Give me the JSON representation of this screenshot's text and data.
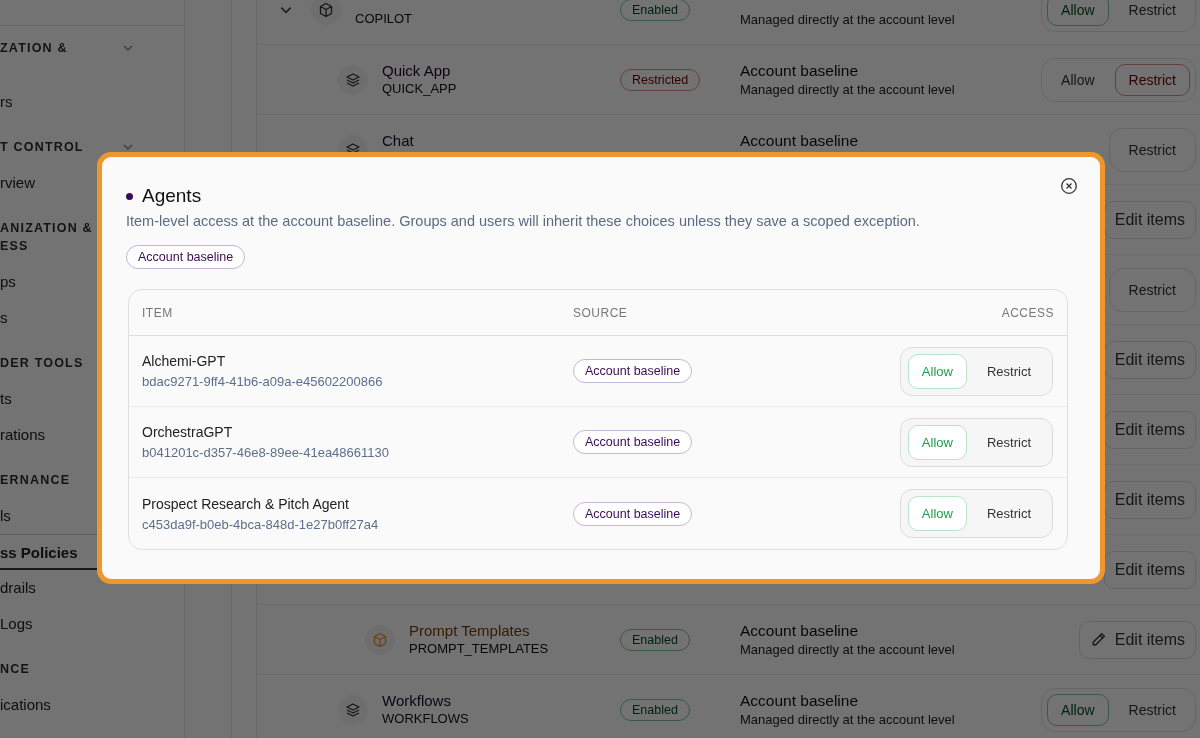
{
  "sidebar": {
    "sections": [
      {
        "heading": [
          "ZATION &"
        ],
        "collapsible": true,
        "items": [
          {
            "label": "rs",
            "selected": false
          }
        ]
      },
      {
        "heading": [
          "T CONTROL"
        ],
        "collapsible": true,
        "items": [
          {
            "label": "rview",
            "selected": false
          }
        ]
      },
      {
        "heading": [
          "ANIZATION &",
          "ESS"
        ],
        "collapsible": false,
        "items": [
          {
            "label": "ps",
            "selected": false
          },
          {
            "label": "s",
            "selected": false
          }
        ]
      },
      {
        "heading": [
          "DER TOOLS"
        ],
        "collapsible": false,
        "items": [
          {
            "label": "ts",
            "selected": false
          },
          {
            "label": "rations",
            "selected": false
          }
        ]
      },
      {
        "heading": [
          "ERNANCE"
        ],
        "collapsible": false,
        "items": [
          {
            "label": "ls",
            "selected": false
          },
          {
            "label": "ss Policies",
            "selected": true
          },
          {
            "label": "drails",
            "selected": false
          },
          {
            "label": "Logs",
            "selected": false
          }
        ]
      },
      {
        "heading": [
          "NCE"
        ],
        "collapsible": false,
        "items": [
          {
            "label": "ications",
            "selected": false
          }
        ]
      }
    ]
  },
  "policies": [
    {
      "kind": "category",
      "expanded": true,
      "code": "COPILOT",
      "status": "Enabled",
      "note": "Managed directly at the account level",
      "access": {
        "kind": "toggle",
        "options": [
          {
            "label": "Allow",
            "selected": true
          },
          {
            "label": "Restrict",
            "selected": false
          }
        ]
      },
      "children": [
        {
          "kind": "tool",
          "name": "Quick App",
          "code": "QUICK_APP",
          "status": "Restricted",
          "source": "Account baseline",
          "note": "Managed directly at the account level",
          "access": {
            "kind": "toggle",
            "options": [
              {
                "label": "Allow",
                "selected": false
              },
              {
                "label": "Restrict",
                "selected": true
              }
            ]
          }
        },
        {
          "kind": "tool",
          "name": "Chat",
          "source": "Account baseline",
          "access": {
            "kind": "toggle",
            "options": [
              {
                "label": "Restrict",
                "selected": false
              }
            ]
          }
        },
        {
          "access": {
            "kind": "edit",
            "label": "Edit items",
            "pencil": false
          }
        },
        {
          "access": {
            "kind": "toggle",
            "options": [
              {
                "label": "Restrict",
                "selected": false
              }
            ]
          }
        },
        {
          "access": {
            "kind": "edit",
            "label": "Edit items",
            "pencil": false
          }
        },
        {
          "access": {
            "kind": "edit",
            "label": "Edit items",
            "pencil": false
          }
        },
        {
          "access": {
            "kind": "edit",
            "label": "Edit items",
            "pencil": false
          }
        },
        {
          "access": {
            "kind": "edit",
            "label": "Edit items",
            "pencil": false
          },
          "children": [
            {
              "kind": "category",
              "highlighted": true,
              "name": "Prompt Templates",
              "code": "PROMPT_TEMPLATES",
              "status": "Enabled",
              "source": "Account baseline",
              "note": "Managed directly at the account level",
              "access": {
                "kind": "edit",
                "label": "Edit items",
                "pencil": true
              }
            }
          ]
        },
        {
          "kind": "tool",
          "name": "Workflows",
          "code": "WORKFLOWS",
          "status": "Enabled",
          "source": "Account baseline",
          "note": "Managed directly at the account level",
          "access": {
            "kind": "toggle",
            "options": [
              {
                "label": "Allow",
                "selected": true
              },
              {
                "label": "Restrict",
                "selected": false
              }
            ]
          }
        }
      ]
    }
  ],
  "modal": {
    "title": "Agents",
    "description": "Item-level access at the account baseline. Groups and users will inherit these choices unless they save a scoped exception.",
    "badge": "Account baseline",
    "columns": [
      "ITEM",
      "SOURCE",
      "ACCESS"
    ],
    "rows": [
      {
        "name": "Alchemi-GPT",
        "id": "bdac9271-9ff4-41b6-a09a-e45602200866",
        "source": "Account baseline",
        "access": [
          {
            "label": "Allow",
            "selected": true
          },
          {
            "label": "Restrict",
            "selected": false
          }
        ]
      },
      {
        "name": "OrchestraGPT",
        "id": "b041201c-d357-46e8-89ee-41ea48661130",
        "source": "Account baseline",
        "access": [
          {
            "label": "Allow",
            "selected": true
          },
          {
            "label": "Restrict",
            "selected": false
          }
        ]
      },
      {
        "name": "Prospect Research & Pitch Agent",
        "id": "c453da9f-b0eb-4bca-848d-1e27b0ff27a4",
        "source": "Account baseline",
        "access": [
          {
            "label": "Allow",
            "selected": true
          },
          {
            "label": "Restrict",
            "selected": false
          }
        ]
      }
    ]
  }
}
